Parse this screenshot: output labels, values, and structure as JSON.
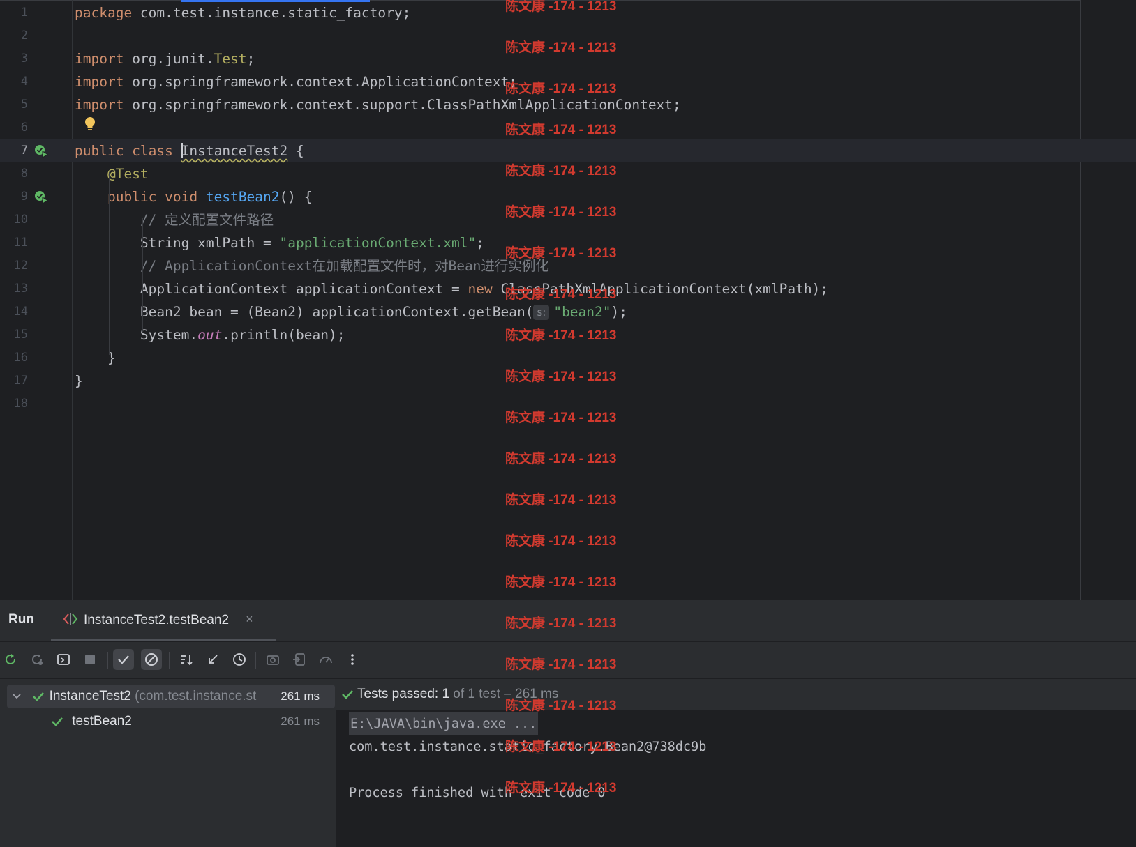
{
  "editor": {
    "lines": [
      {
        "num": "1",
        "tokens": [
          {
            "t": "package",
            "c": "kw"
          },
          {
            "t": " com.test.instance.static_factory;",
            "c": ""
          }
        ]
      },
      {
        "num": "2",
        "tokens": []
      },
      {
        "num": "3",
        "tokens": [
          {
            "t": "import",
            "c": "kw"
          },
          {
            "t": " org.junit.",
            "c": ""
          },
          {
            "t": "Test",
            "c": "ann"
          },
          {
            "t": ";",
            "c": ""
          }
        ]
      },
      {
        "num": "4",
        "tokens": [
          {
            "t": "import",
            "c": "kw"
          },
          {
            "t": " org.springframework.context.ApplicationContext;",
            "c": ""
          }
        ]
      },
      {
        "num": "5",
        "tokens": [
          {
            "t": "import",
            "c": "kw"
          },
          {
            "t": " org.springframework.context.support.ClassPathXmlApplicationContext;",
            "c": ""
          }
        ]
      },
      {
        "num": "6",
        "tokens": []
      },
      {
        "num": "7",
        "current": true,
        "run": true,
        "tokens": [
          {
            "t": "public class ",
            "c": "kw"
          },
          {
            "t": "CARET",
            "c": "caret"
          },
          {
            "t": "InstanceTest2",
            "c": "squig"
          },
          {
            "t": " {",
            "c": ""
          }
        ]
      },
      {
        "num": "8",
        "tokens": [
          {
            "t": "    ",
            "c": ""
          },
          {
            "t": "@Test",
            "c": "ann"
          }
        ]
      },
      {
        "num": "9",
        "run": true,
        "tokens": [
          {
            "t": "    ",
            "c": ""
          },
          {
            "t": "public void ",
            "c": "kw"
          },
          {
            "t": "testBean2",
            "c": "fn"
          },
          {
            "t": "() {",
            "c": ""
          }
        ]
      },
      {
        "num": "10",
        "tokens": [
          {
            "t": "        ",
            "c": ""
          },
          {
            "t": "// 定义配置文件路径",
            "c": "cmt"
          }
        ]
      },
      {
        "num": "11",
        "tokens": [
          {
            "t": "        String xmlPath = ",
            "c": ""
          },
          {
            "t": "\"applicationContext.xml\"",
            "c": "str"
          },
          {
            "t": ";",
            "c": ""
          }
        ]
      },
      {
        "num": "12",
        "tokens": [
          {
            "t": "        ",
            "c": ""
          },
          {
            "t": "// ApplicationContext在加载配置文件时，对Bean进行实例化",
            "c": "cmt"
          }
        ]
      },
      {
        "num": "13",
        "tokens": [
          {
            "t": "        ApplicationContext applicationContext = ",
            "c": ""
          },
          {
            "t": "new",
            "c": "kw"
          },
          {
            "t": " ClassPathXmlApplicationContext(xmlPath);",
            "c": ""
          }
        ]
      },
      {
        "num": "14",
        "tokens": [
          {
            "t": "        Bean2 bean = (Bean2) applicationContext.getBean(",
            "c": ""
          },
          {
            "t": "s:",
            "c": "hint"
          },
          {
            "t": "\"bean2\"",
            "c": "str"
          },
          {
            "t": ");",
            "c": ""
          }
        ]
      },
      {
        "num": "15",
        "tokens": [
          {
            "t": "        System.",
            "c": ""
          },
          {
            "t": "out",
            "c": "fld"
          },
          {
            "t": ".println(bean);",
            "c": ""
          }
        ]
      },
      {
        "num": "16",
        "tokens": [
          {
            "t": "    }",
            "c": ""
          }
        ]
      },
      {
        "num": "17",
        "tokens": [
          {
            "t": "}",
            "c": ""
          }
        ]
      },
      {
        "num": "18",
        "tokens": []
      }
    ]
  },
  "run_panel": {
    "title": "Run",
    "tab_label": "InstanceTest2.testBean2",
    "tab_close": "×",
    "toolbar_icons": [
      "rerun-icon",
      "rerun-failed-icon",
      "toggle-auto-test-icon",
      "stop-icon",
      "show-passed-icon",
      "show-ignored-icon",
      "sort-icon",
      "collapse-icon",
      "history-icon",
      "screenshot-icon",
      "export-icon",
      "coverage-icon",
      "more-icon"
    ],
    "tree": [
      {
        "name": "InstanceTest2",
        "pkg": " (com.test.instance.st",
        "time": "261 ms"
      },
      {
        "name": "testBean2",
        "pkg": "",
        "time": "261 ms"
      }
    ],
    "status": {
      "label": "Tests passed: ",
      "count": "1",
      "rest": " of 1 test – 261 ms"
    },
    "console": [
      "E:\\JAVA\\bin\\java.exe ...",
      "com.test.instance.static_factory.Bean2@738dc9b",
      "",
      "Process finished with exit code 0"
    ]
  },
  "watermark": "陈文康 -174 - 1213",
  "colors": {
    "accent": "#3574f0",
    "pass": "#5fb865",
    "watermark": "#d23a2f"
  }
}
